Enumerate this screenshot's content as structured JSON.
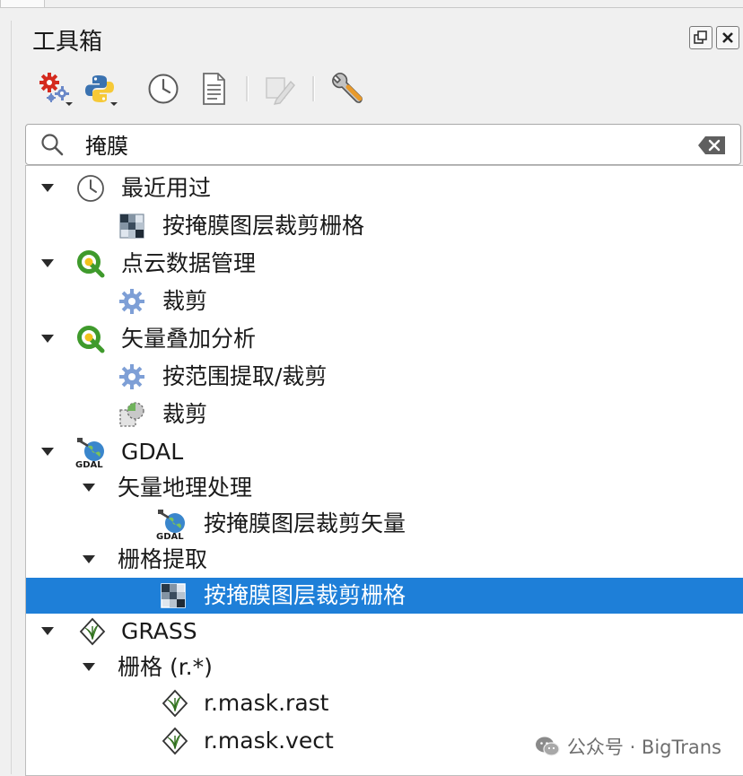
{
  "panel": {
    "title": "工具箱"
  },
  "toolbar": {
    "buttons": [
      {
        "name": "models-icon"
      },
      {
        "name": "python-icon"
      },
      {
        "name": "history-icon"
      },
      {
        "name": "results-viewer-icon"
      },
      {
        "name": "edit-features-icon"
      },
      {
        "name": "options-icon"
      }
    ]
  },
  "search": {
    "value": "掩膜"
  },
  "tree": {
    "recent": {
      "label": "最近用过",
      "items": [
        "按掩膜图层裁剪栅格"
      ]
    },
    "pointcloud": {
      "label": "点云数据管理",
      "items": [
        "裁剪"
      ]
    },
    "vectoroverlay": {
      "label": "矢量叠加分析",
      "items": [
        "按范围提取/裁剪",
        "裁剪"
      ]
    },
    "gdal": {
      "label": "GDAL",
      "vector_geoprocessing": {
        "label": "矢量地理处理",
        "items": [
          "按掩膜图层裁剪矢量"
        ]
      },
      "raster_extraction": {
        "label": "栅格提取",
        "items": [
          "按掩膜图层裁剪栅格"
        ]
      }
    },
    "grass": {
      "label": "GRASS",
      "raster": {
        "label": "栅格 (r.*)",
        "items": [
          "r.mask.rast",
          "r.mask.vect"
        ]
      }
    }
  },
  "selection_color": "#1e7fd8",
  "watermark": "公众号 · BigTrans"
}
